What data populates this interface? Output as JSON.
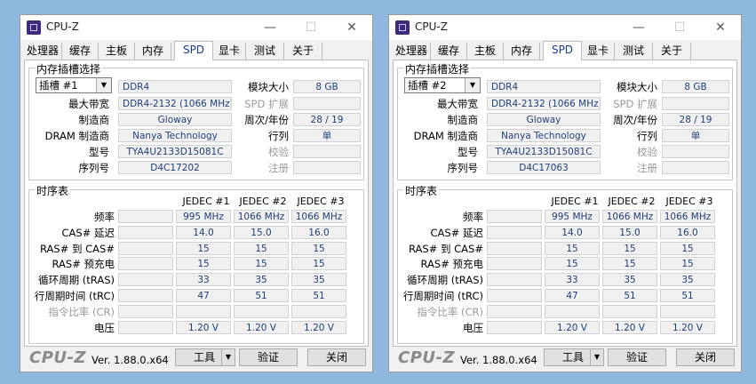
{
  "windows": [
    {
      "title": "CPU-Z",
      "tabs": [
        "处理器",
        "缓存",
        "主板",
        "内存",
        "SPD",
        "显卡",
        "测试",
        "关于"
      ],
      "active_tab": "SPD",
      "slot_group_title": "内存插槽选择",
      "slot_select": "插槽 #1",
      "memory_type": "DDR4",
      "module_size_label": "模块大小",
      "module_size": "8 GB",
      "max_bandwidth_label": "最大带宽",
      "max_bandwidth": "DDR4-2132 (1066 MHz)",
      "spd_ext_label": "SPD 扩展",
      "spd_ext": "",
      "manufacturer_label": "制造商",
      "manufacturer": "Gloway",
      "week_year_label": "周次/年份",
      "week_year": "28 / 19",
      "dram_mfr_label": "DRAM 制造商",
      "dram_mfr": "Nanya Technology",
      "ranks_label": "行列",
      "ranks": "单",
      "part_label": "型号",
      "part_number": "TYA4U2133D15081C",
      "correction_label": "校验",
      "correction": "",
      "serial_label": "序列号",
      "serial": "D4C17202",
      "registered_label": "注册",
      "registered": "",
      "timing_title": "时序表",
      "timing_headers": [
        "JEDEC #1",
        "JEDEC #2",
        "JEDEC #3"
      ],
      "timing_rows": [
        {
          "label": "频率",
          "values": [
            "995 MHz",
            "1066 MHz",
            "1066 MHz"
          ]
        },
        {
          "label": "CAS# 延迟",
          "values": [
            "14.0",
            "15.0",
            "16.0"
          ]
        },
        {
          "label": "RAS# 到 CAS#",
          "values": [
            "15",
            "15",
            "15"
          ]
        },
        {
          "label": "RAS# 预充电",
          "values": [
            "15",
            "15",
            "15"
          ]
        },
        {
          "label": "循环周期 (tRAS)",
          "values": [
            "33",
            "35",
            "35"
          ]
        },
        {
          "label": "行周期时间 (tRC)",
          "values": [
            "47",
            "51",
            "51"
          ]
        },
        {
          "label": "指令比率 (CR)",
          "values": [
            "",
            "",
            ""
          ]
        },
        {
          "label": "电压",
          "values": [
            "1.20 V",
            "1.20 V",
            "1.20 V"
          ]
        }
      ],
      "footer_logo": "CPU-Z",
      "version": "Ver. 1.88.0.x64",
      "tools_label": "工具",
      "validate_label": "验证",
      "close_label": "关闭"
    },
    {
      "title": "CPU-Z",
      "tabs": [
        "处理器",
        "缓存",
        "主板",
        "内存",
        "SPD",
        "显卡",
        "测试",
        "关于"
      ],
      "active_tab": "SPD",
      "slot_group_title": "内存插槽选择",
      "slot_select": "插槽 #2",
      "memory_type": "DDR4",
      "module_size_label": "模块大小",
      "module_size": "8 GB",
      "max_bandwidth_label": "最大带宽",
      "max_bandwidth": "DDR4-2132 (1066 MHz)",
      "spd_ext_label": "SPD 扩展",
      "spd_ext": "",
      "manufacturer_label": "制造商",
      "manufacturer": "Gloway",
      "week_year_label": "周次/年份",
      "week_year": "28 / 19",
      "dram_mfr_label": "DRAM 制造商",
      "dram_mfr": "Nanya Technology",
      "ranks_label": "行列",
      "ranks": "单",
      "part_label": "型号",
      "part_number": "TYA4U2133D15081C",
      "correction_label": "校验",
      "correction": "",
      "serial_label": "序列号",
      "serial": "D4C17063",
      "registered_label": "注册",
      "registered": "",
      "timing_title": "时序表",
      "timing_headers": [
        "JEDEC #1",
        "JEDEC #2",
        "JEDEC #3"
      ],
      "timing_rows": [
        {
          "label": "频率",
          "values": [
            "995 MHz",
            "1066 MHz",
            "1066 MHz"
          ]
        },
        {
          "label": "CAS# 延迟",
          "values": [
            "14.0",
            "15.0",
            "16.0"
          ]
        },
        {
          "label": "RAS# 到 CAS#",
          "values": [
            "15",
            "15",
            "15"
          ]
        },
        {
          "label": "RAS# 预充电",
          "values": [
            "15",
            "15",
            "15"
          ]
        },
        {
          "label": "循环周期 (tRAS)",
          "values": [
            "33",
            "35",
            "35"
          ]
        },
        {
          "label": "行周期时间 (tRC)",
          "values": [
            "47",
            "51",
            "51"
          ]
        },
        {
          "label": "指令比率 (CR)",
          "values": [
            "",
            "",
            ""
          ]
        },
        {
          "label": "电压",
          "values": [
            "1.20 V",
            "1.20 V",
            "1.20 V"
          ]
        }
      ],
      "footer_logo": "CPU-Z",
      "version": "Ver. 1.88.0.x64",
      "tools_label": "工具",
      "validate_label": "验证",
      "close_label": "关闭"
    }
  ]
}
